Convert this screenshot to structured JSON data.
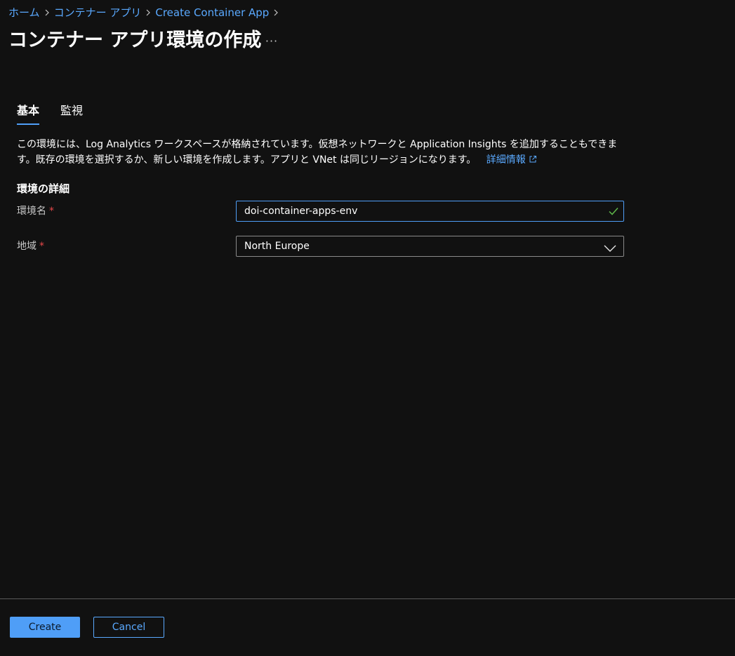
{
  "breadcrumb": {
    "items": [
      "ホーム",
      "コンテナー アプリ",
      "Create Container App"
    ]
  },
  "header": {
    "title": "コンテナー アプリ環境の作成",
    "more_label": "···"
  },
  "tabs": [
    {
      "label": "基本",
      "active": true
    },
    {
      "label": "監視",
      "active": false
    }
  ],
  "description": {
    "text": "この環境には、Log Analytics ワークスペースが格納されています。仮想ネットワークと Application Insights を追加することもできます。既存の環境を選択するか、新しい環境を作成します。アプリと VNet は同じリージョンになります。",
    "link_label": "詳細情報"
  },
  "section": {
    "heading": "環境の詳細"
  },
  "fields": {
    "env_name": {
      "label": "環境名",
      "required_mark": "*",
      "value": "doi-container-apps-env",
      "valid": true
    },
    "region": {
      "label": "地域",
      "required_mark": "*",
      "value": "North Europe"
    }
  },
  "footer": {
    "create_label": "Create",
    "cancel_label": "Cancel"
  },
  "colors": {
    "background": "#111111",
    "accent": "#4f9ef7",
    "link": "#5aa9ff",
    "required": "#e8484a",
    "valid": "#5fb84a"
  }
}
